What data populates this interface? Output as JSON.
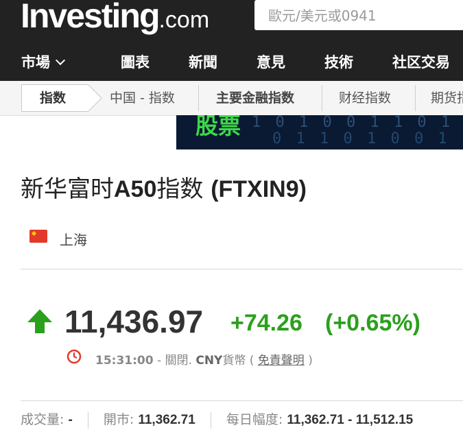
{
  "header": {
    "logo_main": "Investing",
    "logo_suffix": ".com",
    "search_placeholder": "歐元/美元或0941"
  },
  "nav": {
    "items": [
      {
        "label": "市場"
      },
      {
        "label": "圖表"
      },
      {
        "label": "新聞"
      },
      {
        "label": "意見"
      },
      {
        "label": "技術"
      },
      {
        "label": "社区交易"
      }
    ]
  },
  "subnav": {
    "items": [
      {
        "label": "指数"
      },
      {
        "label": "中国 - 指数"
      },
      {
        "label": "主要金融指数"
      },
      {
        "label": "财经指数"
      },
      {
        "label": "期货指"
      }
    ]
  },
  "banner": {
    "text": "股票"
  },
  "instrument": {
    "name_prefix": "新华富时",
    "name_a50": "A50",
    "name_suffix": "指数",
    "symbol": "(FTXIN9)",
    "location": "上海"
  },
  "quote": {
    "price": "11,436.97",
    "change": "+74.26",
    "change_pct": "(+0.65%)",
    "time": "15:31:00",
    "status": "- 關閉.",
    "currency": "CNY",
    "currency_label": "貨幣",
    "open_paren": "(",
    "disclaimer": "免責聲明",
    "close_paren": ")"
  },
  "stats": {
    "volume_label": "成交量:",
    "volume_value": "-",
    "open_label": "開市:",
    "open_value": "11,362.71",
    "range_label": "每日幅度:",
    "range_value": "11,362.71 - 11,512.15"
  },
  "colors": {
    "up": "#2ba01c",
    "header_bg": "#222222",
    "clock": "#e23a2a"
  }
}
